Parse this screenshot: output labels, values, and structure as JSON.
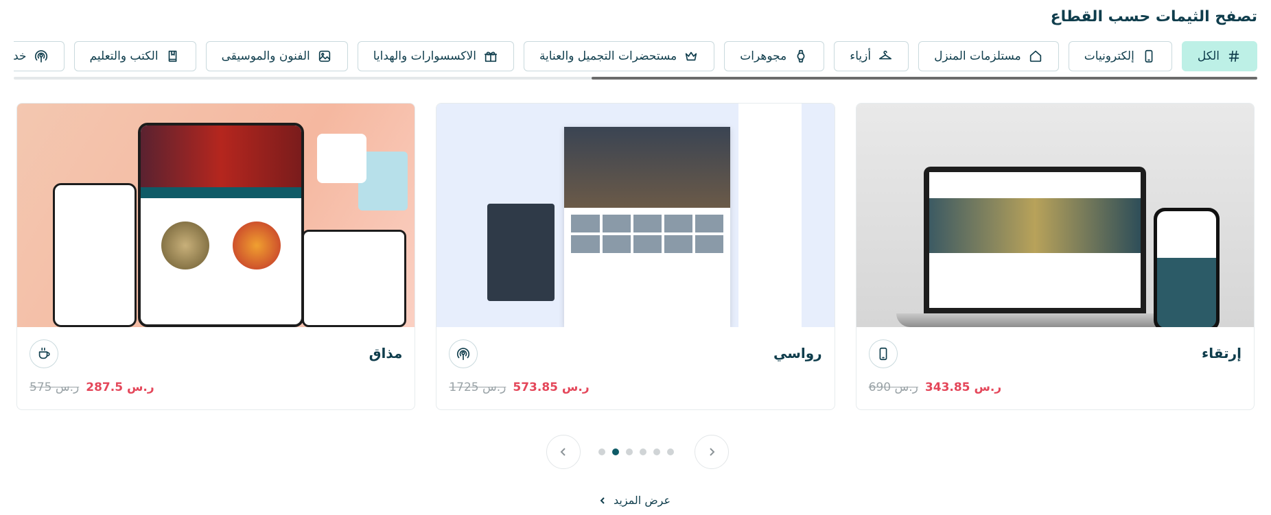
{
  "section": {
    "title": "تصفح الثيمات حسب القطاع"
  },
  "categories": [
    {
      "label": "الكل",
      "icon": "hash-icon",
      "active": true
    },
    {
      "label": "إلكترونيات",
      "icon": "phone-icon"
    },
    {
      "label": "مستلزمات المنزل",
      "icon": "home-icon"
    },
    {
      "label": "أزياء",
      "icon": "hanger-icon"
    },
    {
      "label": "مجوهرات",
      "icon": "watch-icon"
    },
    {
      "label": "مستحضرات التجميل والعناية",
      "icon": "crown-icon"
    },
    {
      "label": "الاكسسوارات والهدايا",
      "icon": "gift-icon"
    },
    {
      "label": "الفنون والموسيقى",
      "icon": "image-icon"
    },
    {
      "label": "الكتب والتعليم",
      "icon": "book-icon"
    },
    {
      "label": "خدمات",
      "icon": "broadcast-icon"
    }
  ],
  "cards": [
    {
      "name": "إرتقاء",
      "icon": "phone-icon",
      "price_new": "343.85",
      "price_old": "690",
      "currency": "ر.س"
    },
    {
      "name": "رواسي",
      "icon": "broadcast-icon",
      "price_new": "573.85",
      "price_old": "1725",
      "currency": "ر.س"
    },
    {
      "name": "مذاق",
      "icon": "cup-icon",
      "price_new": "287.5",
      "price_old": "575",
      "currency": "ر.س"
    }
  ],
  "pager": {
    "dots": 6,
    "active_index": 1
  },
  "show_more": {
    "label": "عرض المزيد"
  },
  "colors": {
    "accent": "#0f5b67",
    "active_chip": "#bdf0e6",
    "price": "#e4475a"
  }
}
